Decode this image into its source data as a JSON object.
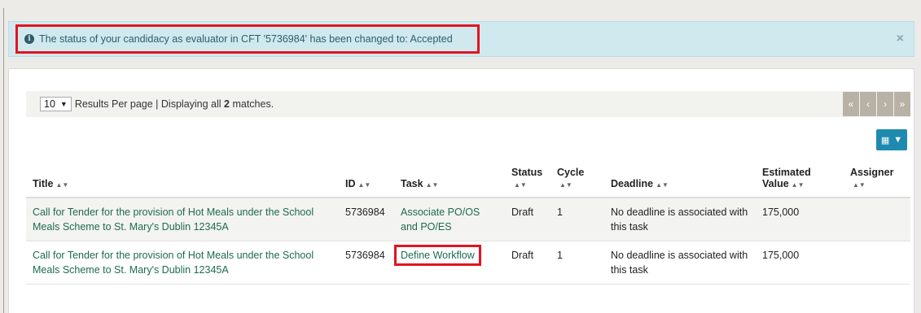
{
  "alert": {
    "message": "The status of your candidacy as evaluator in CFT '5736984' has been changed to: Accepted",
    "close": "×"
  },
  "pager": {
    "per_page": "10",
    "text_prefix": "Results Per page | Displaying all ",
    "count": "2",
    "text_suffix": " matches.",
    "buttons": [
      "«",
      "‹",
      "›",
      "»"
    ]
  },
  "columns": {
    "title": "Title",
    "id": "ID",
    "task": "Task",
    "status": "Status",
    "cycle": "Cycle",
    "deadline": "Deadline",
    "estimated_value_1": "Estimated",
    "estimated_value_2": "Value",
    "assigner": "Assigner"
  },
  "rows": [
    {
      "title": "Call for Tender for the provision of Hot Meals under the School Meals Scheme to St. Mary's Dublin 12345A",
      "id": "5736984",
      "task": "Associate PO/OS and PO/ES",
      "status": "Draft",
      "cycle": "1",
      "deadline": "No deadline is associated with this task",
      "estimated_value": "175,000",
      "assigner": ""
    },
    {
      "title": "Call for Tender for the provision of Hot Meals under the School Meals Scheme to St. Mary's Dublin 12345A",
      "id": "5736984",
      "task": "Define Workflow",
      "status": "Draft",
      "cycle": "1",
      "deadline": "No deadline is associated with this task",
      "estimated_value": "175,000",
      "assigner": ""
    }
  ],
  "colors": {
    "highlight": "#e3141f",
    "link": "#1e6b4e",
    "alert_bg": "#cfe9ef",
    "accent": "#1f8ab0"
  }
}
